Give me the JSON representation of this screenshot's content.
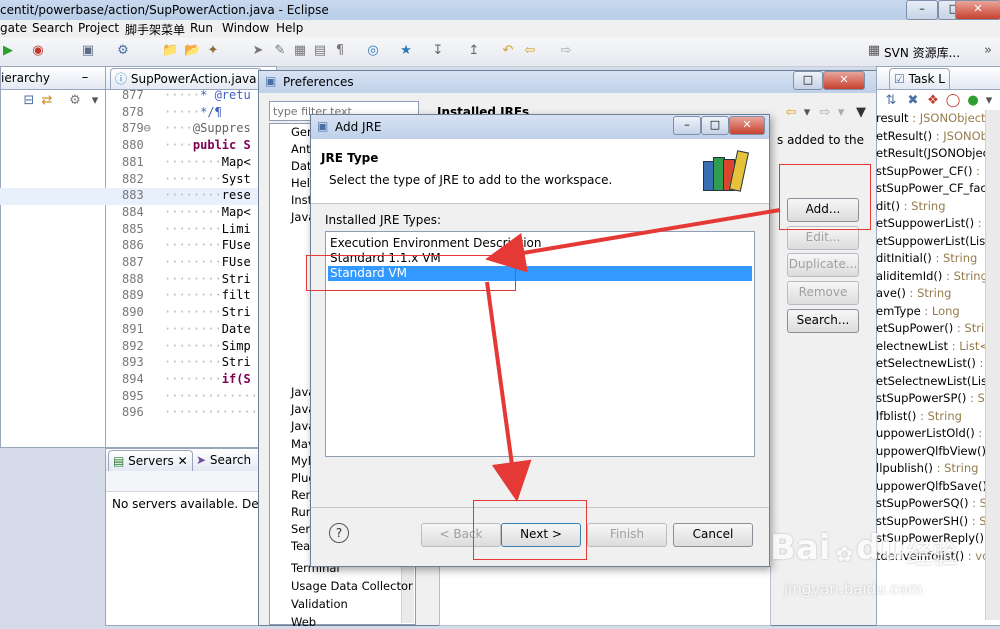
{
  "window": {
    "title": "centit/powerbase/action/SupPowerAction.java - Eclipse"
  },
  "menu": [
    "gate",
    "Search",
    "Project",
    "脚手架菜单",
    "Run",
    "Window",
    "Help"
  ],
  "toolbar": {
    "svn_label": "SVN 资源库..."
  },
  "left_tabs": {
    "hierarchy": "ierarchy",
    "editor_tab": "SupPowerAction.java"
  },
  "code": [
    {
      "ln": "877",
      "dots": "·····",
      "text": "* @retu",
      "cls": "comment"
    },
    {
      "ln": "878",
      "dots": "·····",
      "text": "*/¶",
      "cls": "comment"
    },
    {
      "ln": "879⊖",
      "dots": "····",
      "text": "@Suppres",
      "cls": "anno"
    },
    {
      "ln": "880",
      "dots": "····",
      "text": "public S",
      "cls": "kw"
    },
    {
      "ln": "881",
      "dots": "········",
      "text": "Map<",
      "cls": ""
    },
    {
      "ln": "882",
      "dots": "········",
      "text": "Syst",
      "cls": ""
    },
    {
      "ln": "883",
      "dots": "········",
      "text": "rese",
      "cls": ""
    },
    {
      "ln": "884",
      "dots": "········",
      "text": "Map<",
      "cls": ""
    },
    {
      "ln": "885",
      "dots": "········",
      "text": "Limi",
      "cls": ""
    },
    {
      "ln": "886",
      "dots": "········",
      "text": "FUse",
      "cls": ""
    },
    {
      "ln": "887",
      "dots": "········",
      "text": "FUse",
      "cls": ""
    },
    {
      "ln": "888",
      "dots": "········",
      "text": "Stri",
      "cls": ""
    },
    {
      "ln": "889",
      "dots": "········",
      "text": "filt",
      "cls": ""
    },
    {
      "ln": "890",
      "dots": "········",
      "text": "Stri",
      "cls": ""
    },
    {
      "ln": "891",
      "dots": "········",
      "text": "Date",
      "cls": ""
    },
    {
      "ln": "892",
      "dots": "········",
      "text": "Simp",
      "cls": ""
    },
    {
      "ln": "893",
      "dots": "········",
      "text": "Stri",
      "cls": ""
    },
    {
      "ln": "894",
      "dots": "········",
      "text": "if(S",
      "cls": "kw"
    },
    {
      "ln": "895",
      "dots": "·············",
      "text": "",
      "cls": ""
    },
    {
      "ln": "896",
      "dots": "·············",
      "text": "",
      "cls": ""
    }
  ],
  "servers": {
    "tab": "Servers",
    "search_tab": "Search",
    "message": "No servers available. Define"
  },
  "preferences": {
    "title": "Preferences",
    "filter_placeholder": "type filter text",
    "header": "Installed JREs",
    "hint": "s added to the",
    "tree": [
      "Gen",
      "Ant",
      "Data",
      "Help",
      "Insta",
      "Java",
      "Java",
      "Java",
      "Java",
      "Mave",
      "Myl",
      "Plug",
      "Rem",
      "Run",
      "Serv",
      "Tea",
      "Terminal",
      "Usage Data Collector",
      "Validation",
      "Web"
    ],
    "buttons": {
      "add": "Add...",
      "edit": "Edit...",
      "duplicate": "Duplicate...",
      "remove": "Remove",
      "search": "Search..."
    }
  },
  "dialog": {
    "title": "Add JRE",
    "heading": "JRE Type",
    "description": "Select the type of JRE to add to the workspace.",
    "list_label": "Installed JRE Types:",
    "types": [
      "Execution Environment Description",
      "Standard 1.1.x VM",
      "Standard VM"
    ],
    "selected_index": 2,
    "buttons": {
      "back": "< Back",
      "next": "Next >",
      "finish": "Finish",
      "cancel": "Cancel"
    }
  },
  "task_tab": "Task L",
  "outline": [
    {
      "name": "result",
      "type": " : JSONObject"
    },
    {
      "name": "etResult()",
      "type": " : JSONOb"
    },
    {
      "name": "etResult(JSONObjec",
      "type": ""
    },
    {
      "name": "stSupPower_CF()",
      "type": " :"
    },
    {
      "name": "stSupPower_CF_faci(",
      "type": ""
    },
    {
      "name": "dit()",
      "type": " : String"
    },
    {
      "name": "etSuppowerList()",
      "type": " : L"
    },
    {
      "name": "etSuppowerList(List)",
      "type": ""
    },
    {
      "name": "ditInitial()",
      "type": " : String"
    },
    {
      "name": "aliditemId()",
      "type": " : String"
    },
    {
      "name": "ave()",
      "type": " : String"
    },
    {
      "name": "emType",
      "type": " : Long"
    },
    {
      "name": "etSupPower()",
      "type": " : String"
    },
    {
      "name": "electnewList",
      "type": " : List<V"
    },
    {
      "name": "etSelectnewList()",
      "type": " : Li"
    },
    {
      "name": "etSelectnewList(List<",
      "type": ""
    },
    {
      "name": "stSupPowerSP()",
      "type": " : Str"
    },
    {
      "name": "lfblist()",
      "type": " : String"
    },
    {
      "name": "uppowerListOld()",
      "type": " :"
    },
    {
      "name": "uppowerQlfbView()",
      "type": ""
    },
    {
      "name": "llpublish()",
      "type": " : String"
    },
    {
      "name": "uppowerQlfbSave()",
      "type": ""
    },
    {
      "name": "stSupPowerSQ()",
      "type": " : St"
    },
    {
      "name": "stSupPowerSH()",
      "type": " : St"
    },
    {
      "name": "stSupPowerReply()",
      "type": ""
    },
    {
      "name": "tderiveinfolist()",
      "type": " : vc"
    }
  ],
  "watermark": {
    "brand": "Bai",
    "brand2": "du",
    "cn": "经验",
    "url": "jingyan.baidu.com"
  },
  "colors": {
    "selection": "#3399ff",
    "annotation_red": "#e53935"
  }
}
